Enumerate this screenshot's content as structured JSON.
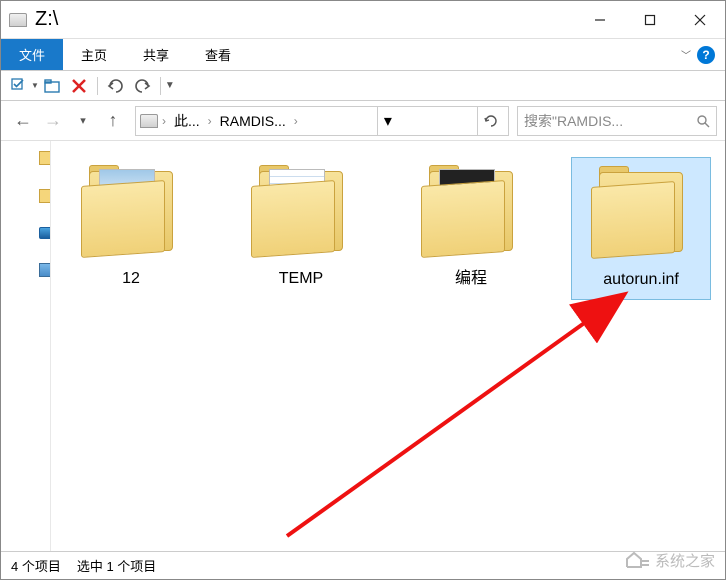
{
  "titlebar": {
    "title": "Z:\\"
  },
  "ribbon": {
    "file": "文件",
    "home": "主页",
    "share": "共享",
    "view": "查看"
  },
  "breadcrumb": {
    "item1": "此...",
    "item2": "RAMDIS..."
  },
  "search": {
    "placeholder": "搜索\"RAMDIS..."
  },
  "items": [
    {
      "label": "12"
    },
    {
      "label": "TEMP"
    },
    {
      "label": "编程"
    },
    {
      "label": "autorun.inf"
    }
  ],
  "status": {
    "count": "4 个项目",
    "selected": "选中 1 个项目"
  },
  "watermark": {
    "text": "系统之家"
  }
}
